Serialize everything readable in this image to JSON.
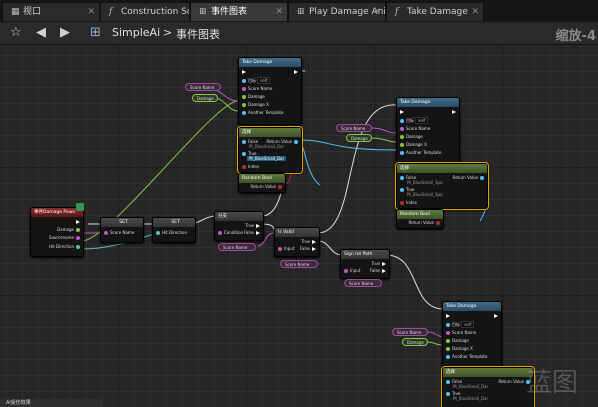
{
  "tabs": [
    {
      "label": "视口",
      "icon": "viewport-icon"
    },
    {
      "label": "Construction Scrip",
      "icon": "function-icon"
    },
    {
      "label": "事件图表",
      "icon": "graph-icon",
      "active": true
    },
    {
      "label": "Play Damage Anim",
      "icon": "graph-icon"
    },
    {
      "label": "Take Damage",
      "icon": "function-icon"
    }
  ],
  "toolbar": {
    "root": "SimpleAi",
    "separator": ">",
    "current": "事件图表",
    "zoom": "缩放-4"
  },
  "nodes": {
    "event": {
      "title": "事件Damage Pawn",
      "pins": [
        "Damage",
        "Sourcename",
        "Hit Direction"
      ]
    },
    "set1": {
      "title": "SET",
      "pin": "Score Name"
    },
    "set2": {
      "title": "SET",
      "pin": "Hit Direction"
    },
    "branch1": {
      "title": "分支",
      "pins": [
        "Condition",
        "True",
        "False"
      ]
    },
    "branch2": {
      "title": "Is Valid",
      "pins": [
        "Input",
        "True",
        "False"
      ]
    },
    "branch3": {
      "title": "Sign Int Path",
      "pins": [
        "Input",
        "True",
        "False"
      ]
    },
    "take1": {
      "title": "Take Damage",
      "sub": "目标是 Actor",
      "pins": [
        "目标",
        "Score Name",
        "Damage",
        "Damage X",
        "Another Template"
      ],
      "self": "self"
    },
    "take2": {
      "title": "Take Damage",
      "sub": "目标是 Actor",
      "pins": [
        "目标",
        "Score Name",
        "Damage",
        "Damage X",
        "Another Template"
      ],
      "self": "self"
    },
    "take3": {
      "title": "Take Damage",
      "sub": "目标是 Actor",
      "pins": [
        "目标",
        "Score Name",
        "Damage",
        "Damage X",
        "Another Template"
      ],
      "self": "self"
    },
    "select1": {
      "title": "选择",
      "pins": [
        "False",
        "True",
        "Index"
      ],
      "ret": "Return Value",
      "falseval": "Pt_BlueSmall_Dar",
      "trueval": "Pt_BlueSmall_Dar"
    },
    "select2": {
      "title": "选择",
      "pins": [
        "False",
        "True",
        "Index"
      ],
      "ret": "Return Value",
      "falseval": "Pt_BlueSmall_Spa",
      "trueval": "Pt_BlueSmall_Spa"
    },
    "select3": {
      "title": "选择",
      "pins": [
        "False",
        "True"
      ],
      "ret": "Return Value",
      "falseval": "Pt_BlueSmall_Dar",
      "trueval": "Pt_BlueSmall_Dar"
    },
    "rand1": {
      "title": "Random Bool",
      "ret": "Return Value"
    },
    "rand2": {
      "title": "Random Bool",
      "ret": "Return Value"
    },
    "vars": {
      "score": "Score Name",
      "damage": "Damage"
    }
  },
  "comment": "Ai受伤效果",
  "watermark": "蓝图"
}
